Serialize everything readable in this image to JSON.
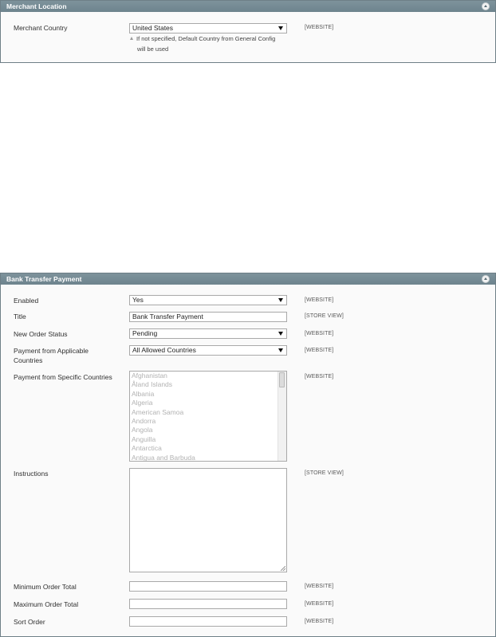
{
  "merchant_location": {
    "title": "Merchant Location",
    "country_label": "Merchant Country",
    "country_value": "United States",
    "scope": "[WEBSITE]",
    "hint_line1": "If not specified, Default Country from General Config",
    "hint_line2": "will be used"
  },
  "bank_transfer": {
    "title": "Bank Transfer Payment",
    "enabled": {
      "label": "Enabled",
      "value": "Yes",
      "scope": "[WEBSITE]"
    },
    "title_field": {
      "label": "Title",
      "value": "Bank Transfer Payment",
      "scope": "[STORE VIEW]"
    },
    "new_order_status": {
      "label": "New Order Status",
      "value": "Pending",
      "scope": "[WEBSITE]"
    },
    "applicable_countries": {
      "label_line1": "Payment from Applicable",
      "label_line2": "Countries",
      "value": "All Allowed Countries",
      "scope": "[WEBSITE]"
    },
    "specific_countries": {
      "label": "Payment from Specific Countries",
      "scope": "[WEBSITE]",
      "options": [
        "Afghanistan",
        "Åland Islands",
        "Albania",
        "Algeria",
        "American Samoa",
        "Andorra",
        "Angola",
        "Anguilla",
        "Antarctica",
        "Antigua and Barbuda"
      ]
    },
    "instructions": {
      "label": "Instructions",
      "value": "",
      "scope": "[STORE VIEW]"
    },
    "min_total": {
      "label": "Minimum Order Total",
      "value": "",
      "scope": "[WEBSITE]"
    },
    "max_total": {
      "label": "Maximum Order Total",
      "value": "",
      "scope": "[WEBSITE]"
    },
    "sort_order": {
      "label": "Sort Order",
      "value": "",
      "scope": "[WEBSITE]"
    }
  }
}
